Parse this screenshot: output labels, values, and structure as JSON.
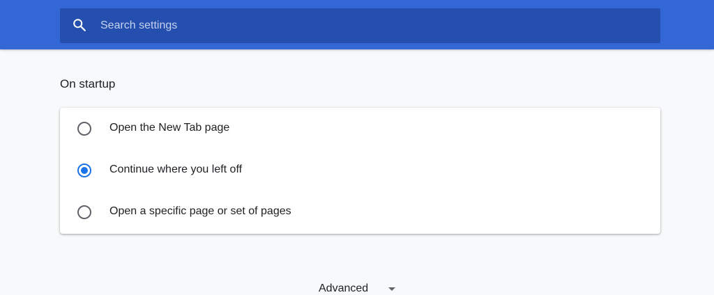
{
  "search": {
    "placeholder": "Search settings",
    "icon": "search-icon"
  },
  "startup": {
    "title": "On startup",
    "options": [
      {
        "label": "Open the New Tab page",
        "selected": false
      },
      {
        "label": "Continue where you left off",
        "selected": true
      },
      {
        "label": "Open a specific page or set of pages",
        "selected": false
      }
    ]
  },
  "advanced": {
    "label": "Advanced",
    "icon": "arrow-drop-down-icon"
  },
  "colors": {
    "header": "#3367d6",
    "search_box": "#254fae",
    "accent": "#1a73e8",
    "background": "#f8f9fa"
  }
}
